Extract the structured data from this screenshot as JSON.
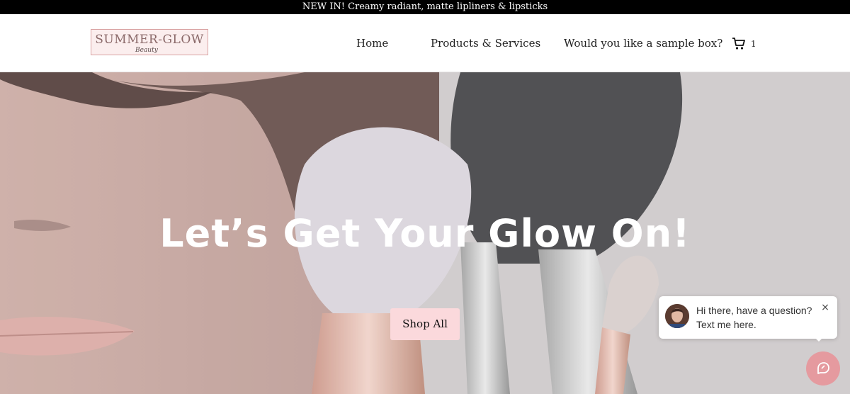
{
  "announcement": {
    "text": "NEW IN! Creamy radiant, matte lipliners & lipsticks"
  },
  "header": {
    "logo": {
      "main": "SUMMER-GLOW",
      "sub": "Beauty"
    },
    "nav": [
      {
        "label": "Home"
      },
      {
        "label": "Products & Services"
      },
      {
        "label": "Would you like a sample box?"
      }
    ],
    "cart": {
      "count": "1"
    }
  },
  "hero": {
    "title": "Let’s Get Your Glow On!",
    "cta_label": "Shop All"
  },
  "chat": {
    "line1": "Hi there, have a question?",
    "line2": "Text me here.",
    "close_icon": "×"
  },
  "colors": {
    "announce_bg": "#000000",
    "cta_bg": "#fbd9dc",
    "chat_launcher": "#e59a9f"
  }
}
